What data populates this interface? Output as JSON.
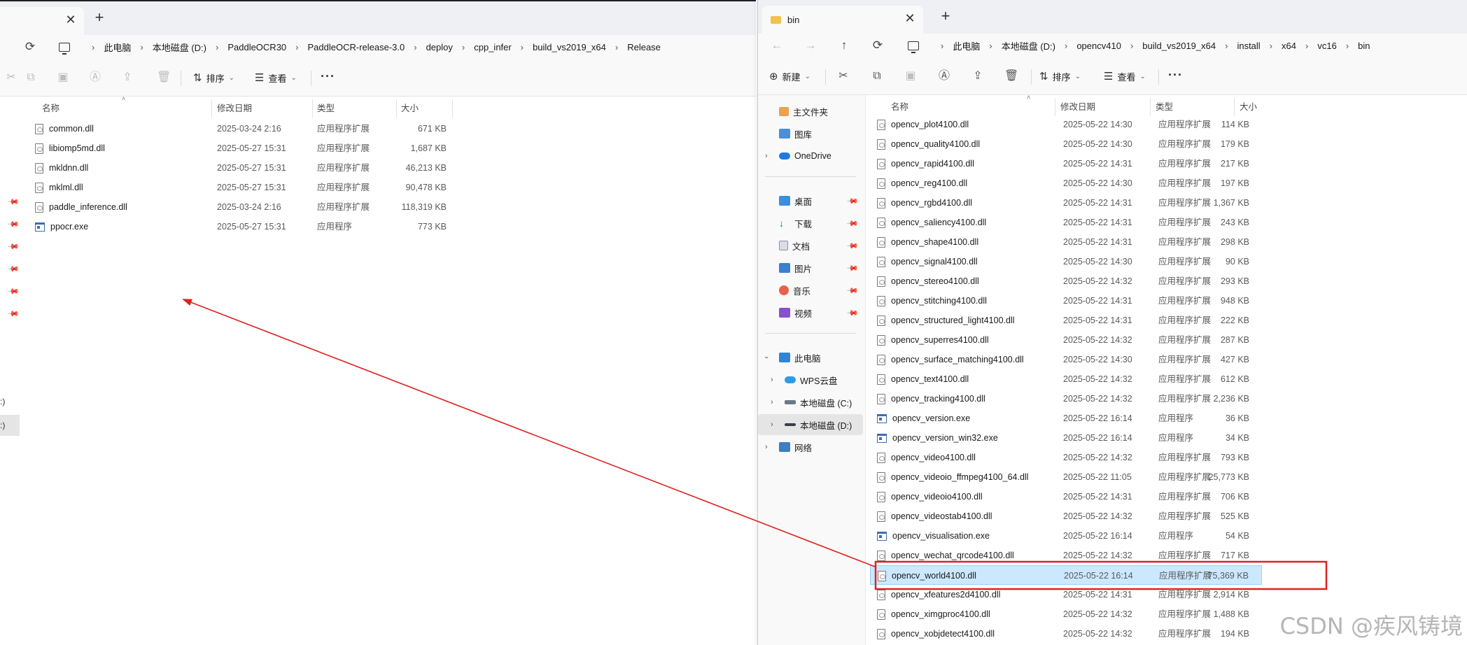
{
  "left_window": {
    "tab_close": "✕",
    "tab_new": "+",
    "refresh": "⟳",
    "breadcrumb": [
      "此电脑",
      "本地磁盘 (D:)",
      "PaddleOCR30",
      "PaddleOCR-release-3.0",
      "deploy",
      "cpp_infer",
      "build_vs2019_x64",
      "Release"
    ],
    "toolbar": {
      "sort_label": "排序",
      "view_label": "查看",
      "more_label": "···"
    },
    "columns": {
      "name": "名称",
      "date": "修改日期",
      "type": "类型",
      "size": "大小"
    },
    "files": [
      {
        "name": "common.dll",
        "date": "2025-03-24 2:16",
        "type": "应用程序扩展",
        "size": "671 KB",
        "icon": "dll"
      },
      {
        "name": "libiomp5md.dll",
        "date": "2025-05-27 15:31",
        "type": "应用程序扩展",
        "size": "1,687 KB",
        "icon": "dll"
      },
      {
        "name": "mkldnn.dll",
        "date": "2025-05-27 15:31",
        "type": "应用程序扩展",
        "size": "46,213 KB",
        "icon": "dll"
      },
      {
        "name": "mklml.dll",
        "date": "2025-05-27 15:31",
        "type": "应用程序扩展",
        "size": "90,478 KB",
        "icon": "dll"
      },
      {
        "name": "paddle_inference.dll",
        "date": "2025-03-24 2:16",
        "type": "应用程序扩展",
        "size": "118,319 KB",
        "icon": "dll"
      },
      {
        "name": "ppocr.exe",
        "date": "2025-05-27 15:31",
        "type": "应用程序",
        "size": "773 KB",
        "icon": "exe"
      }
    ],
    "side_fragments": [
      ":)",
      ":)"
    ]
  },
  "right_window": {
    "tab_title": "bin",
    "tab_close": "✕",
    "tab_new": "+",
    "nav": {
      "back": "←",
      "forward": "→",
      "up": "↑",
      "refresh": "⟳"
    },
    "breadcrumb": [
      "此电脑",
      "本地磁盘 (D:)",
      "opencv410",
      "build_vs2019_x64",
      "install",
      "x64",
      "vc16",
      "bin"
    ],
    "toolbar": {
      "new_label": "新建",
      "sort_label": "排序",
      "view_label": "查看",
      "more_label": "···"
    },
    "columns": {
      "name": "名称",
      "date": "修改日期",
      "type": "类型",
      "size": "大小"
    },
    "navpane": {
      "home": "主文件夹",
      "gallery": "图库",
      "onedrive": "OneDrive",
      "desktop": "桌面",
      "downloads": "下载",
      "documents": "文档",
      "pictures": "图片",
      "music": "音乐",
      "videos": "视频",
      "this_pc": "此电脑",
      "wps": "WPS云盘",
      "drive_c": "本地磁盘 (C:)",
      "drive_d": "本地磁盘 (D:)",
      "network": "网络"
    },
    "files": [
      {
        "name": "opencv_plot4100.dll",
        "date": "2025-05-22 14:30",
        "type": "应用程序扩展",
        "size": "114 KB",
        "icon": "dll"
      },
      {
        "name": "opencv_quality4100.dll",
        "date": "2025-05-22 14:30",
        "type": "应用程序扩展",
        "size": "179 KB",
        "icon": "dll"
      },
      {
        "name": "opencv_rapid4100.dll",
        "date": "2025-05-22 14:31",
        "type": "应用程序扩展",
        "size": "217 KB",
        "icon": "dll"
      },
      {
        "name": "opencv_reg4100.dll",
        "date": "2025-05-22 14:30",
        "type": "应用程序扩展",
        "size": "197 KB",
        "icon": "dll"
      },
      {
        "name": "opencv_rgbd4100.dll",
        "date": "2025-05-22 14:31",
        "type": "应用程序扩展",
        "size": "1,367 KB",
        "icon": "dll"
      },
      {
        "name": "opencv_saliency4100.dll",
        "date": "2025-05-22 14:31",
        "type": "应用程序扩展",
        "size": "243 KB",
        "icon": "dll"
      },
      {
        "name": "opencv_shape4100.dll",
        "date": "2025-05-22 14:31",
        "type": "应用程序扩展",
        "size": "298 KB",
        "icon": "dll"
      },
      {
        "name": "opencv_signal4100.dll",
        "date": "2025-05-22 14:30",
        "type": "应用程序扩展",
        "size": "90 KB",
        "icon": "dll"
      },
      {
        "name": "opencv_stereo4100.dll",
        "date": "2025-05-22 14:32",
        "type": "应用程序扩展",
        "size": "293 KB",
        "icon": "dll"
      },
      {
        "name": "opencv_stitching4100.dll",
        "date": "2025-05-22 14:31",
        "type": "应用程序扩展",
        "size": "948 KB",
        "icon": "dll"
      },
      {
        "name": "opencv_structured_light4100.dll",
        "date": "2025-05-22 14:31",
        "type": "应用程序扩展",
        "size": "222 KB",
        "icon": "dll"
      },
      {
        "name": "opencv_superres4100.dll",
        "date": "2025-05-22 14:32",
        "type": "应用程序扩展",
        "size": "287 KB",
        "icon": "dll"
      },
      {
        "name": "opencv_surface_matching4100.dll",
        "date": "2025-05-22 14:30",
        "type": "应用程序扩展",
        "size": "427 KB",
        "icon": "dll"
      },
      {
        "name": "opencv_text4100.dll",
        "date": "2025-05-22 14:32",
        "type": "应用程序扩展",
        "size": "612 KB",
        "icon": "dll"
      },
      {
        "name": "opencv_tracking4100.dll",
        "date": "2025-05-22 14:32",
        "type": "应用程序扩展",
        "size": "2,236 KB",
        "icon": "dll"
      },
      {
        "name": "opencv_version.exe",
        "date": "2025-05-22 16:14",
        "type": "应用程序",
        "size": "36 KB",
        "icon": "exe"
      },
      {
        "name": "opencv_version_win32.exe",
        "date": "2025-05-22 16:14",
        "type": "应用程序",
        "size": "34 KB",
        "icon": "exe"
      },
      {
        "name": "opencv_video4100.dll",
        "date": "2025-05-22 14:32",
        "type": "应用程序扩展",
        "size": "793 KB",
        "icon": "dll"
      },
      {
        "name": "opencv_videoio_ffmpeg4100_64.dll",
        "date": "2025-05-22 11:05",
        "type": "应用程序扩展",
        "size": "25,773 KB",
        "icon": "dll"
      },
      {
        "name": "opencv_videoio4100.dll",
        "date": "2025-05-22 14:31",
        "type": "应用程序扩展",
        "size": "706 KB",
        "icon": "dll"
      },
      {
        "name": "opencv_videostab4100.dll",
        "date": "2025-05-22 14:32",
        "type": "应用程序扩展",
        "size": "525 KB",
        "icon": "dll"
      },
      {
        "name": "opencv_visualisation.exe",
        "date": "2025-05-22 16:14",
        "type": "应用程序",
        "size": "54 KB",
        "icon": "exe"
      },
      {
        "name": "opencv_wechat_qrcode4100.dll",
        "date": "2025-05-22 14:32",
        "type": "应用程序扩展",
        "size": "717 KB",
        "icon": "dll"
      },
      {
        "name": "opencv_world4100.dll",
        "date": "2025-05-22 16:14",
        "type": "应用程序扩展",
        "size": "75,369 KB",
        "icon": "dll",
        "selected": true
      },
      {
        "name": "opencv_xfeatures2d4100.dll",
        "date": "2025-05-22 14:31",
        "type": "应用程序扩展",
        "size": "2,914 KB",
        "icon": "dll"
      },
      {
        "name": "opencv_ximgproc4100.dll",
        "date": "2025-05-22 14:32",
        "type": "应用程序扩展",
        "size": "1,488 KB",
        "icon": "dll"
      },
      {
        "name": "opencv_xobjdetect4100.dll",
        "date": "2025-05-22 14:32",
        "type": "应用程序扩展",
        "size": "194 KB",
        "icon": "dll"
      }
    ]
  },
  "annotation": {
    "highlight_color": "#e02020",
    "arrow_color": "#e02020"
  },
  "watermark": "CSDN @疾风铸境",
  "colors": {
    "selection_bg": "#cce8ff",
    "selection_border": "#99d1ff",
    "tabstrip_bg": "#eef0f3"
  }
}
